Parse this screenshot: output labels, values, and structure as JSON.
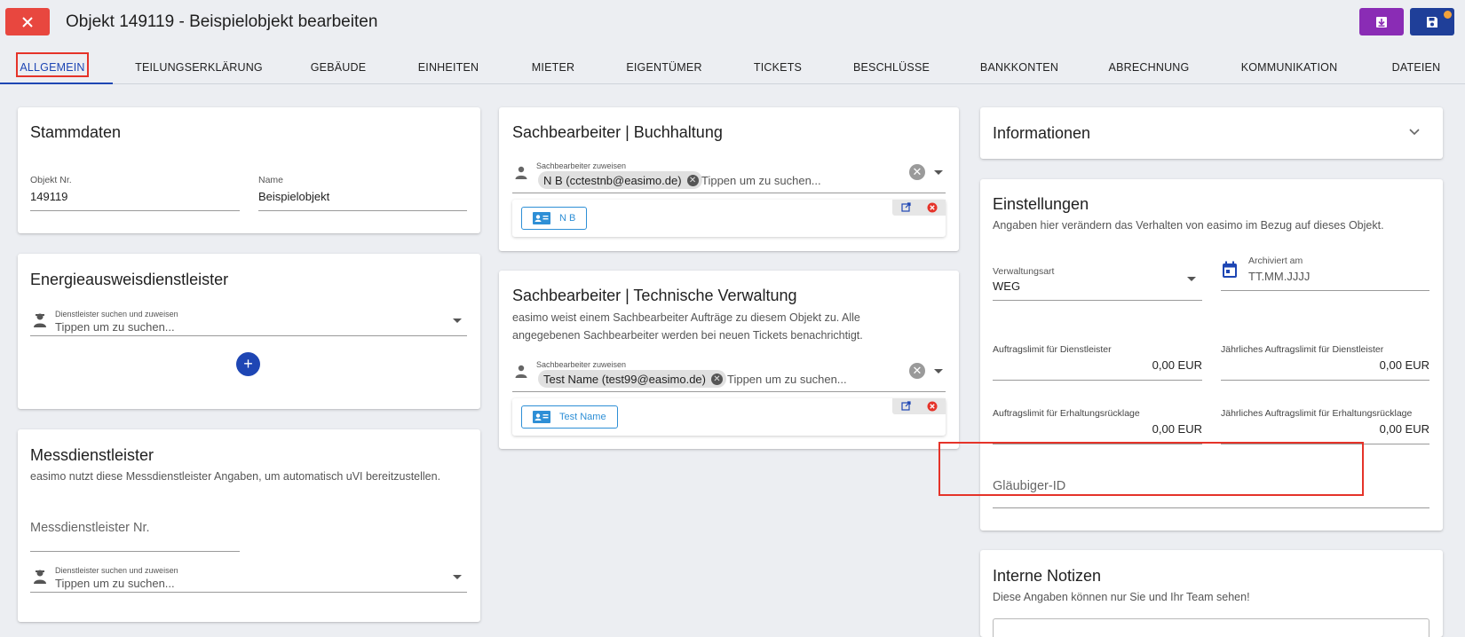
{
  "header": {
    "title": "Objekt 149119 - Beispielobjekt bearbeiten",
    "colors": {
      "close": "#e8473f",
      "download": "#8a2cb5",
      "save": "#1f3f99",
      "badge": "#f3a23a"
    }
  },
  "tabs": [
    {
      "label": "Allgemein",
      "active": true
    },
    {
      "label": "Teilungserklärung"
    },
    {
      "label": "Gebäude"
    },
    {
      "label": "Einheiten"
    },
    {
      "label": "Mieter"
    },
    {
      "label": "Eigentümer"
    },
    {
      "label": "Tickets"
    },
    {
      "label": "Beschlüsse"
    },
    {
      "label": "Bankkonten"
    },
    {
      "label": "Abrechnung"
    },
    {
      "label": "Kommunikation"
    },
    {
      "label": "Dateien"
    }
  ],
  "stammdaten": {
    "title": "Stammdaten",
    "objekt_nr_label": "Objekt Nr.",
    "objekt_nr_value": "149119",
    "name_label": "Name",
    "name_value": "Beispielobjekt"
  },
  "energie": {
    "title": "Energieausweisdienstleister",
    "search_label": "Dienstleister suchen und zuweisen",
    "search_placeholder": "Tippen um zu suchen..."
  },
  "mess": {
    "title": "Messdienstleister",
    "subtitle": "easimo nutzt diese Messdienstleister Angaben, um automatisch uVI bereitzustellen.",
    "nr_placeholder": "Messdienstleister Nr.",
    "search_label": "Dienstleister suchen und zuweisen",
    "search_placeholder": "Tippen um zu suchen..."
  },
  "buchhaltung": {
    "title": "Sachbearbeiter | Buchhaltung",
    "assign_label": "Sachbearbeiter zuweisen",
    "chip": "N B (cctestnb@easimo.de)",
    "search_placeholder": "Tippen um zu suchen...",
    "person": "N B"
  },
  "technisch": {
    "title": "Sachbearbeiter | Technische Verwaltung",
    "subtitle": "easimo weist einem Sachbearbeiter Aufträge zu diesem Objekt zu. Alle angegebenen Sachbearbeiter werden bei neuen Tickets benachrichtigt.",
    "assign_label": "Sachbearbeiter zuweisen",
    "chip": "Test Name (test99@easimo.de)",
    "search_placeholder": "Tippen um zu suchen...",
    "person": "Test Name"
  },
  "informationen": {
    "title": "Informationen"
  },
  "einstellungen": {
    "title": "Einstellungen",
    "subtitle": "Angaben hier verändern das Verhalten von easimo im Bezug auf dieses Objekt.",
    "verwaltungsart_label": "Verwaltungsart",
    "verwaltungsart_value": "WEG",
    "archiviert_label": "Archiviert am",
    "archiviert_value": "TT.MM.JJJJ",
    "auftragslimit_dl_label": "Auftragslimit für Dienstleister",
    "auftragslimit_dl_value": "0,00 EUR",
    "jaehrl_dl_label": "Jährliches Auftragslimit für Dienstleister",
    "jaehrl_dl_value": "0,00 EUR",
    "auftragslimit_er_label": "Auftragslimit für Erhaltungsrücklage",
    "auftragslimit_er_value": "0,00 EUR",
    "jaehrl_er_label": "Jährliches Auftragslimit für Erhaltungsrücklage",
    "jaehrl_er_value": "0,00 EUR",
    "glaeubiger_placeholder": "Gläubiger-ID"
  },
  "notizen": {
    "title": "Interne Notizen",
    "subtitle": "Diese Angaben können nur Sie und Ihr Team sehen!"
  }
}
